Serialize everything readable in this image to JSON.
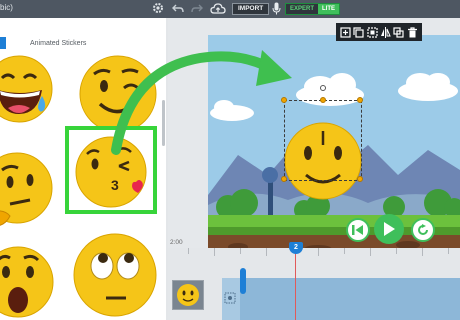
{
  "window": {
    "title_fragment": "bic)"
  },
  "topbar": {
    "import_label": "IMPORT",
    "mode_expert": "EXPERT",
    "mode_lite": "LITE"
  },
  "sticker_panel": {
    "title": "Animated Stickers",
    "stickers": [
      "laughing-tears-emoji",
      "winking-smile-emoji",
      "thinking-emoji",
      "kissing-wink-emoji",
      "shocked-emoji",
      "eyes-rolling-emoji"
    ],
    "selected": "kissing-wink-emoji"
  },
  "canvas_toolbar": {
    "icons": [
      "bring-front-icon",
      "send-back-icon",
      "group-icon",
      "flip-icon",
      "duplicate-icon",
      "delete-icon"
    ]
  },
  "timeline": {
    "start_time": "2:00",
    "playhead_label": "2"
  },
  "colors": {
    "accent_green": "#37d43a",
    "accent_blue": "#1e7fd6",
    "emoji_yellow": "#f5c518"
  }
}
